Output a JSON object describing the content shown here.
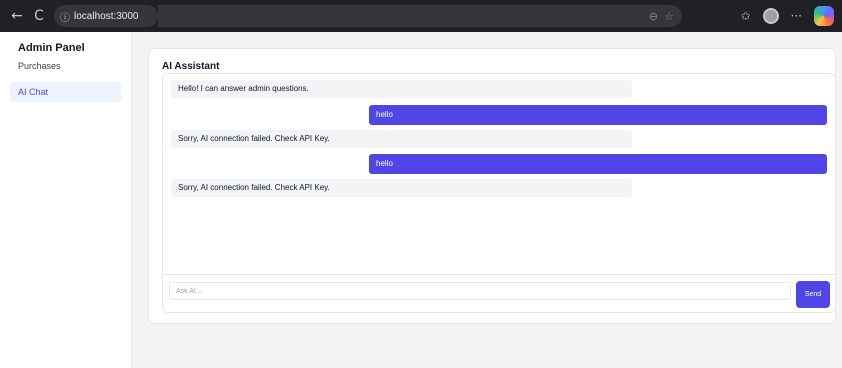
{
  "browser": {
    "back_icon": "←",
    "reload_icon": "C",
    "info_icon": "ⓘ",
    "url": "localhost:3000",
    "zoom_icon": "⊖",
    "favorite_icon": "☆",
    "favorites_icon": "✩",
    "more_icon": "···"
  },
  "sidebar": {
    "title": "Admin Panel",
    "items": [
      {
        "label": "Purchases"
      },
      {
        "label": "AI Chat"
      }
    ]
  },
  "chat": {
    "title": "AI Assistant",
    "messages": [
      {
        "role": "ai",
        "text": "Hello! I can answer admin questions."
      },
      {
        "role": "user",
        "text": "hello"
      },
      {
        "role": "ai",
        "text": "Sorry, AI connection failed. Check API Key."
      },
      {
        "role": "user",
        "text": "hello"
      },
      {
        "role": "ai",
        "text": "Sorry, AI connection failed. Check API Key."
      }
    ],
    "input_placeholder": "Ask AI...",
    "send_label": "Send"
  },
  "colors": {
    "accent": "#4f46e5",
    "active_bg": "#eef2ff",
    "ai_bubble": "#f3f4f6"
  }
}
